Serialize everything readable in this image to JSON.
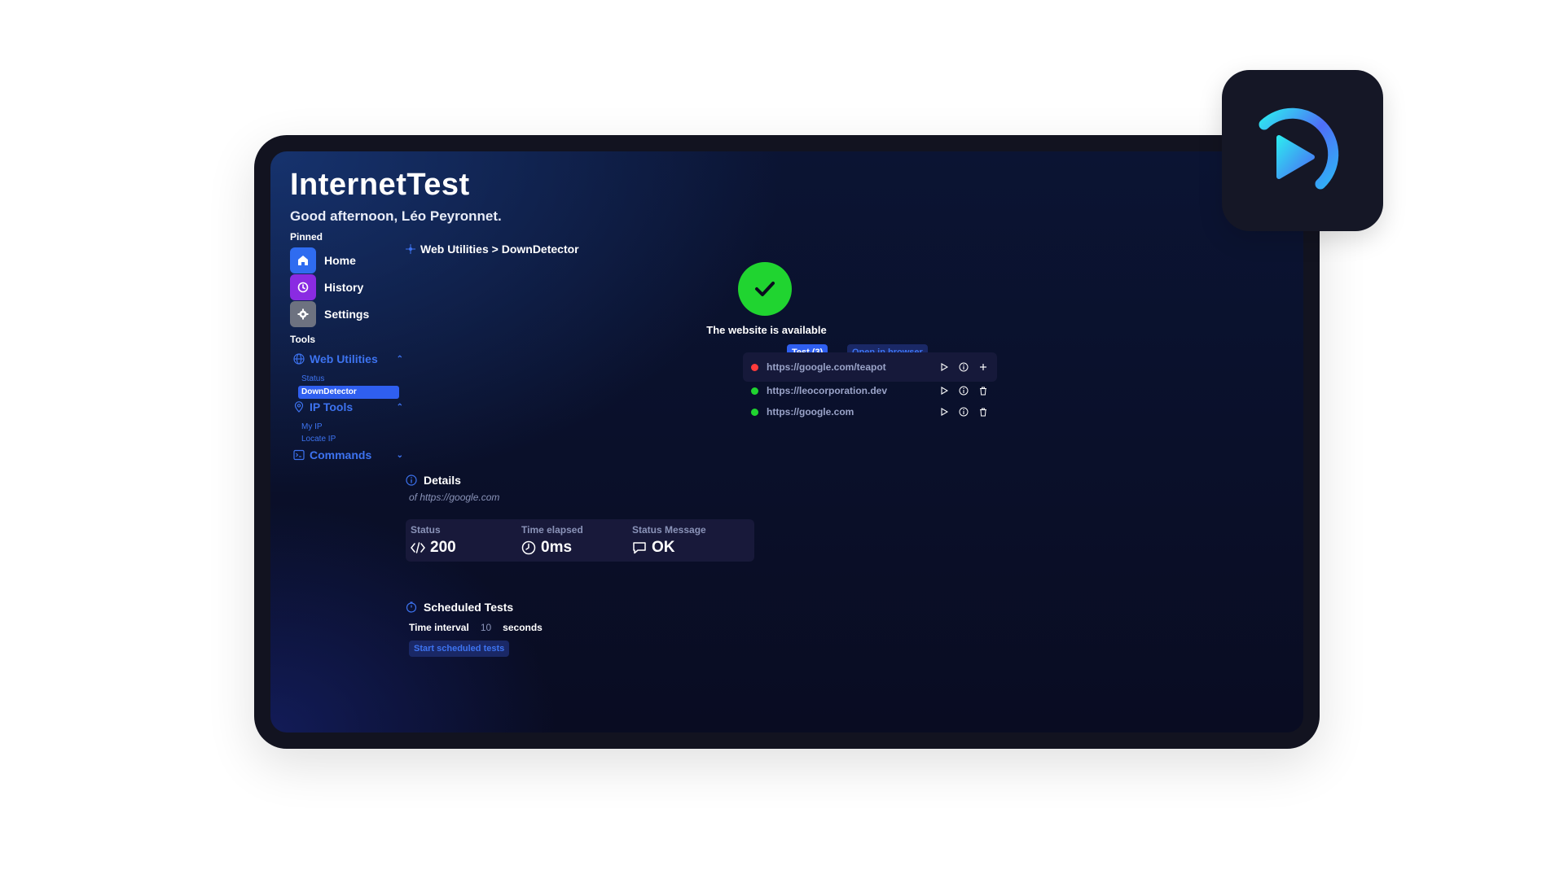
{
  "app": {
    "title": "InternetTest",
    "greeting": "Good afternoon, Léo Peyronnet."
  },
  "sidebar": {
    "pinned_label": "Pinned",
    "pinned": [
      {
        "label": "Home",
        "icon": "home-icon",
        "color": "#2f6cf0"
      },
      {
        "label": "History",
        "icon": "history-icon",
        "color": "#8a2be2"
      },
      {
        "label": "Settings",
        "icon": "gear-icon",
        "color": "#6d7280"
      }
    ],
    "tools_label": "Tools",
    "groups": [
      {
        "label": "Web Utilities",
        "icon": "globe-icon",
        "expanded": true,
        "items": [
          "Status",
          "DownDetector"
        ],
        "active": "DownDetector"
      },
      {
        "label": "IP Tools",
        "icon": "location-pin-icon",
        "expanded": true,
        "items": [
          "My IP",
          "Locate IP"
        ]
      },
      {
        "label": "Commands",
        "icon": "terminal-icon",
        "expanded": false,
        "items": []
      }
    ]
  },
  "main": {
    "breadcrumb": "Web Utilities > DownDetector",
    "status_text": "The website is available",
    "test_button": "Test (3)",
    "open_button": "Open in browser",
    "urls": [
      {
        "url": "https://google.com/teapot",
        "status": "error",
        "action": "add"
      },
      {
        "url": "https://leocorporation.dev",
        "status": "ok",
        "action": "delete"
      },
      {
        "url": "https://google.com",
        "status": "ok",
        "action": "delete"
      }
    ],
    "details": {
      "title": "Details",
      "subtitle": "of https://google.com",
      "cards": [
        {
          "label": "Status",
          "value": "200",
          "icon": "code-icon"
        },
        {
          "label": "Time elapsed",
          "value": "0ms",
          "icon": "clock-icon"
        },
        {
          "label": "Status Message",
          "value": "OK",
          "icon": "chat-bubble-icon"
        }
      ]
    },
    "scheduled": {
      "title": "Scheduled Tests",
      "interval_label": "Time interval",
      "interval_value": "10",
      "interval_unit": "seconds",
      "start_button": "Start scheduled tests"
    }
  },
  "colors": {
    "accent": "#2f5ff0",
    "link": "#3d73f0",
    "success": "#20d430",
    "error": "#ff3b3b"
  }
}
